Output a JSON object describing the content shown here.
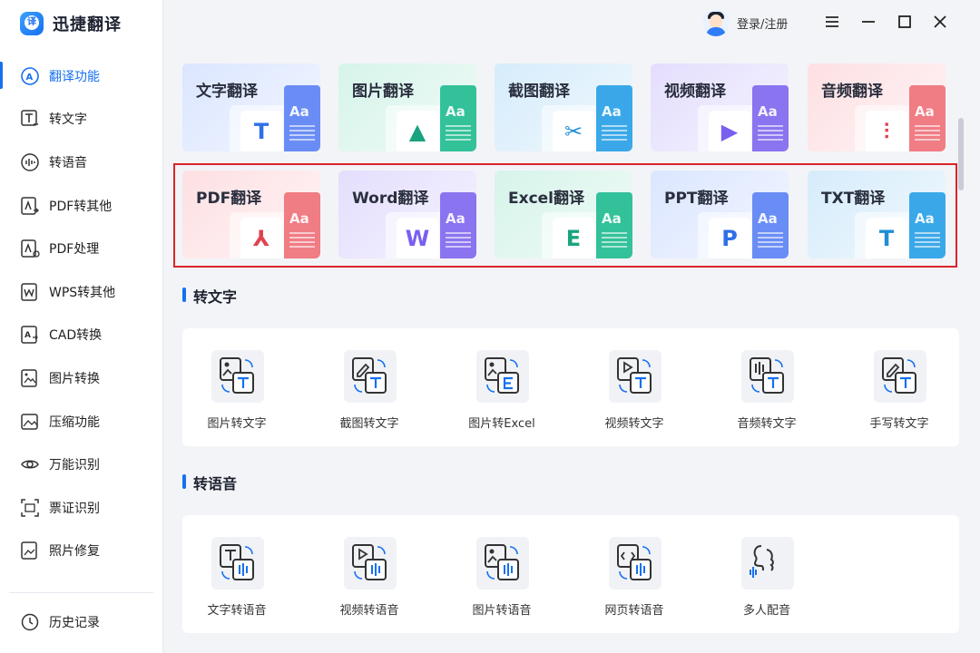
{
  "app": {
    "title": "迅捷翻译"
  },
  "header": {
    "user_label": "登录/注册"
  },
  "sidebar": {
    "items": [
      {
        "label": "翻译功能",
        "icon": "translate-icon",
        "active": true
      },
      {
        "label": "转文字",
        "icon": "to-text-icon"
      },
      {
        "label": "转语音",
        "icon": "to-speech-icon"
      },
      {
        "label": "PDF转其他",
        "icon": "pdf-convert-icon"
      },
      {
        "label": "PDF处理",
        "icon": "pdf-process-icon"
      },
      {
        "label": "WPS转其他",
        "icon": "wps-convert-icon"
      },
      {
        "label": "CAD转换",
        "icon": "cad-convert-icon"
      },
      {
        "label": "图片转换",
        "icon": "image-convert-icon"
      },
      {
        "label": "压缩功能",
        "icon": "compress-icon"
      },
      {
        "label": "万能识别",
        "icon": "universal-recognize-icon"
      },
      {
        "label": "票证识别",
        "icon": "ticket-recognize-icon"
      },
      {
        "label": "照片修复",
        "icon": "photo-repair-icon"
      }
    ],
    "history_label": "历史记录"
  },
  "translate_cards": [
    {
      "label": "文字翻译",
      "badge": "T",
      "icon": "text-translate-icon",
      "color": "#6a8df5",
      "bg": "#dbe6ff",
      "badge_color": "#2f6fe8"
    },
    {
      "label": "图片翻译",
      "badge": "▲",
      "icon": "image-translate-icon",
      "color": "#33c19a",
      "bg": "#d6f4ea",
      "badge_color": "#1aa37e"
    },
    {
      "label": "截图翻译",
      "badge": "✂",
      "icon": "screenshot-translate-icon",
      "color": "#3aa8e8",
      "bg": "#d6ecfb",
      "badge_color": "#1e8ed6"
    },
    {
      "label": "视频翻译",
      "badge": "▶",
      "icon": "video-translate-icon",
      "color": "#8b74f0",
      "bg": "#e4defd",
      "badge_color": "#7a5ef0"
    },
    {
      "label": "音频翻译",
      "badge": "⫶",
      "icon": "audio-translate-icon",
      "color": "#f07c84",
      "bg": "#fde0e3",
      "badge_color": "#e0424f"
    },
    {
      "label": "PDF翻译",
      "badge": "⅄",
      "icon": "pdf-translate-icon",
      "color": "#f07c84",
      "bg": "#fde0e3",
      "badge_color": "#e0424f"
    },
    {
      "label": "Word翻译",
      "badge": "W",
      "icon": "word-translate-icon",
      "color": "#8b74f0",
      "bg": "#e4defd",
      "badge_color": "#7a5ef0"
    },
    {
      "label": "Excel翻译",
      "badge": "E",
      "icon": "excel-translate-icon",
      "color": "#33c19a",
      "bg": "#d6f4ea",
      "badge_color": "#1aa37e"
    },
    {
      "label": "PPT翻译",
      "badge": "P",
      "icon": "ppt-translate-icon",
      "color": "#6a8df5",
      "bg": "#dbe6ff",
      "badge_color": "#2f6fe8"
    },
    {
      "label": "TXT翻译",
      "badge": "T",
      "icon": "txt-translate-icon",
      "color": "#3aa8e8",
      "bg": "#d6ecfb",
      "badge_color": "#1e8ed6"
    }
  ],
  "sections": {
    "to_text": {
      "title": "转文字",
      "tools": [
        {
          "label": "图片转文字",
          "icon": "image-to-text-icon"
        },
        {
          "label": "截图转文字",
          "icon": "screenshot-to-text-icon"
        },
        {
          "label": "图片转Excel",
          "icon": "image-to-excel-icon"
        },
        {
          "label": "视频转文字",
          "icon": "video-to-text-icon"
        },
        {
          "label": "音频转文字",
          "icon": "audio-to-text-icon"
        },
        {
          "label": "手写转文字",
          "icon": "handwriting-to-text-icon"
        }
      ]
    },
    "to_speech": {
      "title": "转语音",
      "tools": [
        {
          "label": "文字转语音",
          "icon": "text-to-speech-icon"
        },
        {
          "label": "视频转语音",
          "icon": "video-to-speech-icon"
        },
        {
          "label": "图片转语音",
          "icon": "image-to-speech-icon"
        },
        {
          "label": "网页转语音",
          "icon": "webpage-to-speech-icon"
        },
        {
          "label": "多人配音",
          "icon": "multi-voice-dubbing-icon"
        }
      ]
    }
  },
  "colors": {
    "accent": "#1770f0",
    "highlight_border": "#d9252b"
  }
}
